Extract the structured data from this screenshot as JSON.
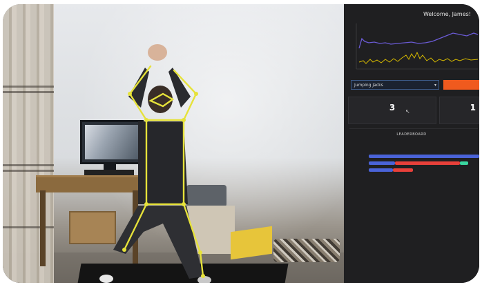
{
  "camera": {
    "overlay_text": "",
    "skeleton_color": "#e6e23a"
  },
  "dashboard": {
    "welcome": "Welcome, James!",
    "accent_color": "#f05a1e",
    "chart": {
      "series": [
        {
          "color": "#6b5bd6"
        },
        {
          "color": "#d4b800"
        }
      ]
    },
    "exercise_select": {
      "value": "Jumping Jacks"
    },
    "start_label": "",
    "stats": [
      {
        "value": "3",
        "label": ""
      },
      {
        "value": "1",
        "label": ""
      }
    ],
    "leaderboard": {
      "title": "LEADERBOARD",
      "subtitle": "",
      "rows": [
        {
          "name": "",
          "score": 1.0,
          "segments": [
            {
              "color": "#4a63d8",
              "fraction": 1.0
            }
          ]
        },
        {
          "name": "",
          "score": 0.95,
          "segments": [
            {
              "color": "#4a63d8",
              "fraction": 0.25
            },
            {
              "color": "#e8403a",
              "fraction": 0.62
            },
            {
              "color": "#3ad6a0",
              "fraction": 0.08
            }
          ]
        },
        {
          "name": "",
          "score": 0.4,
          "segments": [
            {
              "color": "#4a63d8",
              "fraction": 0.55
            },
            {
              "color": "#e8403a",
              "fraction": 0.45
            }
          ]
        }
      ]
    }
  }
}
